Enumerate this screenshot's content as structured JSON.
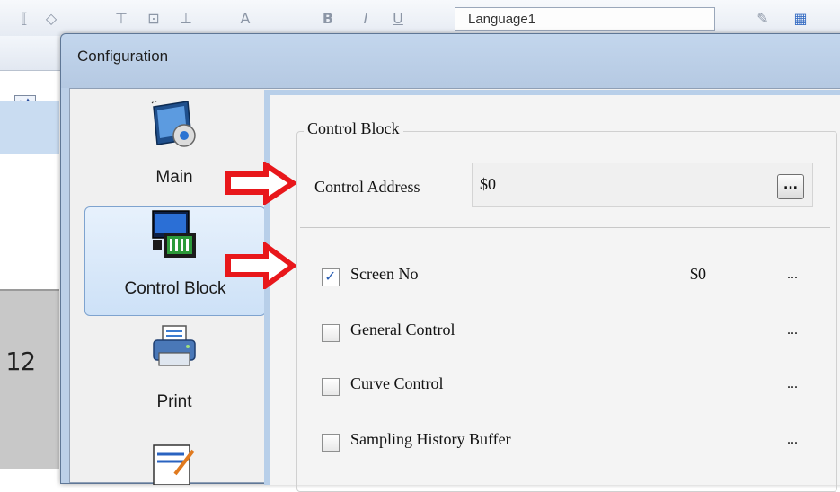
{
  "background_app": {
    "language_box": "Language1",
    "number_display": "12"
  },
  "dialog": {
    "title": "Configuration"
  },
  "nav": {
    "items": [
      {
        "label": "Main",
        "icon": "main-config-icon"
      },
      {
        "label": "Control Block",
        "icon": "control-block-icon"
      },
      {
        "label": "Print",
        "icon": "printer-icon"
      },
      {
        "label": "",
        "icon": "edit-icon"
      }
    ],
    "active": "Control Block"
  },
  "panel": {
    "group_title": "Control Block",
    "control_address_label": "Control Address",
    "control_address_value": "$0",
    "browse_label": "...",
    "options": [
      {
        "label": "Screen No",
        "checked": true,
        "value": "$0",
        "more": "..."
      },
      {
        "label": "General Control",
        "checked": false,
        "value": "",
        "more": "..."
      },
      {
        "label": "Curve Control",
        "checked": false,
        "value": "",
        "more": "..."
      },
      {
        "label": "Sampling History Buffer",
        "checked": false,
        "value": "",
        "more": "..."
      }
    ]
  },
  "colors": {
    "annotation_arrow": "#e8171b",
    "nav_active_bg": "#d6e6f8",
    "dialog_frame": "#bcd0e8"
  }
}
